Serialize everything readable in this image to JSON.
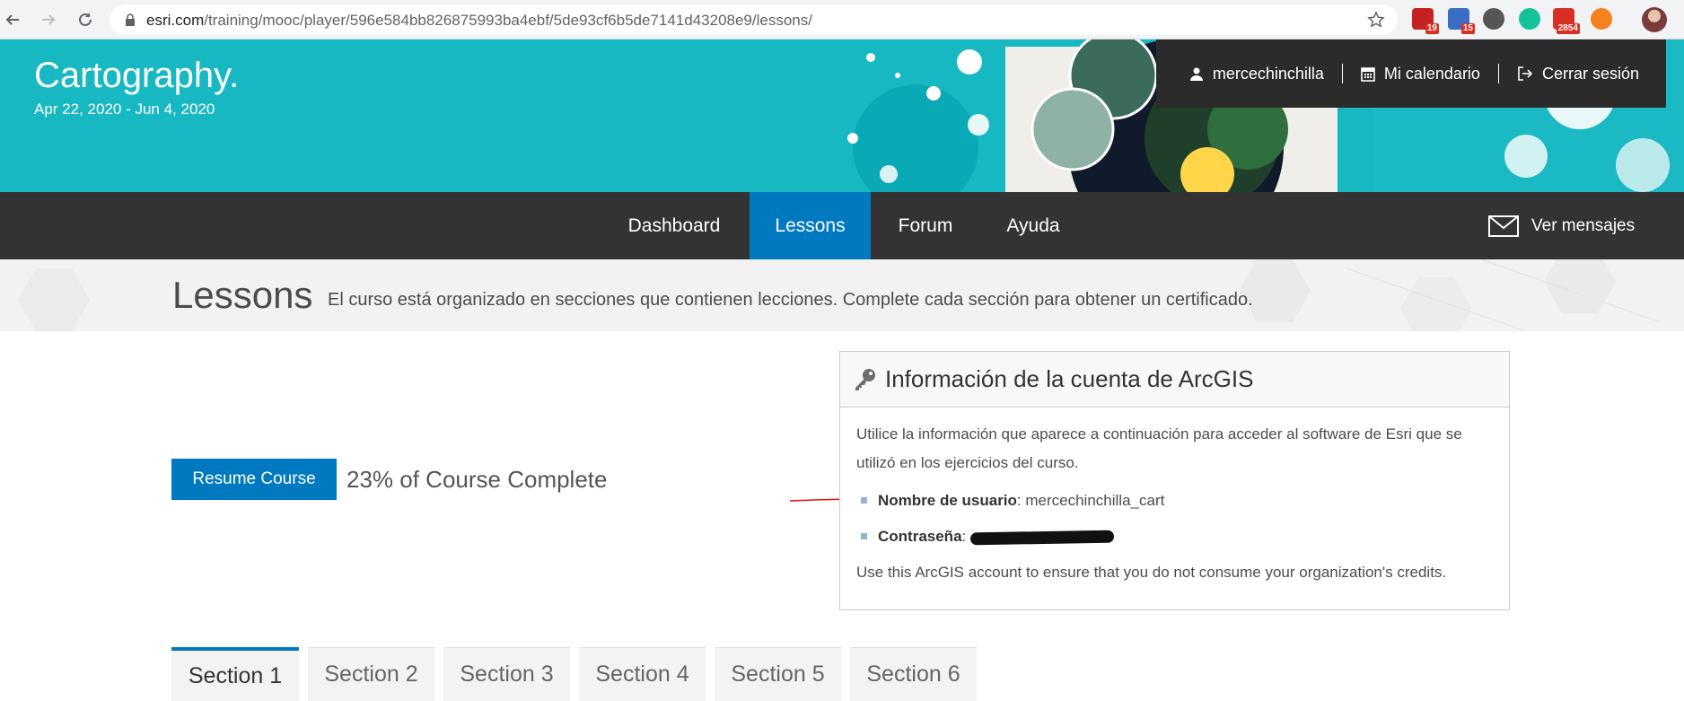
{
  "browser": {
    "url_host": "esri.com",
    "url_path": "/training/mooc/player/596e584bb826875993ba4ebf/5de93cf6b5de7141d43208e9/lessons/",
    "extensions": [
      {
        "name": "gmail-extension",
        "badge": "19",
        "color": "#c5221f"
      },
      {
        "name": "calendar-extension",
        "badge": "15",
        "color": "#3c6dc5"
      },
      {
        "name": "record-extension",
        "badge": "",
        "color": "#555555"
      },
      {
        "name": "grammarly-extension",
        "badge": "",
        "color": "#15c39a"
      },
      {
        "name": "mail-extension",
        "badge": "2854",
        "color": "#d93025"
      },
      {
        "name": "honey-extension",
        "badge": "",
        "color": "#f5821f"
      }
    ]
  },
  "banner": {
    "title": "Cartography.",
    "dates": "Apr 22, 2020 - Jun 4, 2020"
  },
  "user_bar": {
    "username": "mercechinchilla",
    "calendar": "Mi calendario",
    "logout": "Cerrar sesión"
  },
  "nav": {
    "items": [
      {
        "label": "Dashboard",
        "active": false
      },
      {
        "label": "Lessons",
        "active": true
      },
      {
        "label": "Forum",
        "active": false
      },
      {
        "label": "Ayuda",
        "active": false
      }
    ],
    "messages": "Ver mensajes"
  },
  "page": {
    "title": "Lessons",
    "description": "El curso está organizado en secciones que contienen lecciones. Complete cada sección para obtener un certificado."
  },
  "resume": {
    "button": "Resume Course",
    "progress": "23% of Course Complete",
    "percent": 23
  },
  "account_panel": {
    "title": "Información de la cuenta de ArcGIS",
    "intro": "Utilice la información que aparece a continuación para acceder al software de Esri que se utilizó en los ejercicios del curso.",
    "username_label": "Nombre de usuario",
    "username_value": "mercechinchilla_cart",
    "password_label": "Contraseña",
    "note": "Use this ArcGIS account to ensure that you do not consume your organization's credits."
  },
  "sections": [
    {
      "label": "Section 1",
      "active": true
    },
    {
      "label": "Section 2",
      "active": false
    },
    {
      "label": "Section 3",
      "active": false
    },
    {
      "label": "Section 4",
      "active": false
    },
    {
      "label": "Section 5",
      "active": false
    },
    {
      "label": "Section 6",
      "active": false
    }
  ],
  "colors": {
    "banner": "#18b8c3",
    "nav": "#333333",
    "accent": "#0079c1"
  }
}
